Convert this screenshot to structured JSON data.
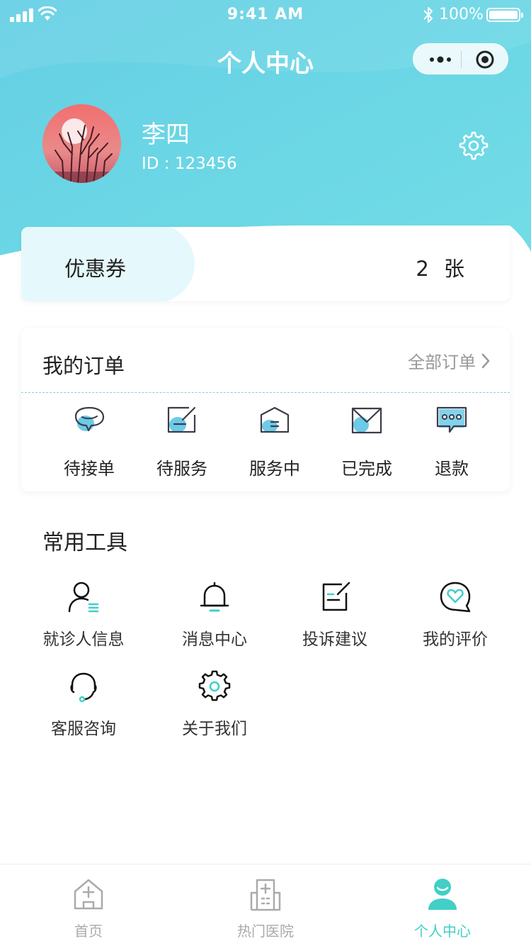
{
  "status_bar": {
    "time": "9:41 AM",
    "battery": "100%"
  },
  "nav": {
    "title": "个人中心"
  },
  "user": {
    "name": "李四",
    "id_label": "ID : ",
    "id_value": "123456"
  },
  "coupon": {
    "label": "优惠券",
    "count": "2",
    "unit": "张"
  },
  "orders": {
    "title": "我的订单",
    "view_all": "全部订单",
    "items": [
      {
        "label": "待接单",
        "icon": "chat-bubble-icon"
      },
      {
        "label": "待服务",
        "icon": "pending-service-icon"
      },
      {
        "label": "服务中",
        "icon": "in-service-icon"
      },
      {
        "label": "已完成",
        "icon": "completed-envelope-icon"
      },
      {
        "label": "退款",
        "icon": "refund-message-icon"
      }
    ]
  },
  "tools": {
    "title": "常用工具",
    "items": [
      {
        "label": "就诊人信息",
        "icon": "patient-info-icon"
      },
      {
        "label": "消息中心",
        "icon": "bell-icon"
      },
      {
        "label": "投诉建议",
        "icon": "complaint-edit-icon"
      },
      {
        "label": "我的评价",
        "icon": "review-heart-icon"
      },
      {
        "label": "客服咨询",
        "icon": "headset-icon"
      },
      {
        "label": "关于我们",
        "icon": "gear-icon"
      }
    ]
  },
  "tabbar": {
    "items": [
      {
        "label": "首页",
        "icon": "home-icon",
        "active": false
      },
      {
        "label": "热门医院",
        "icon": "hospital-icon",
        "active": false
      },
      {
        "label": "个人中心",
        "icon": "profile-icon",
        "active": true
      }
    ]
  },
  "colors": {
    "accent": "#41cfc6",
    "header": "#6ad4e6",
    "icon_fill": "#6ccbe8",
    "divider": "#7ad3df"
  }
}
